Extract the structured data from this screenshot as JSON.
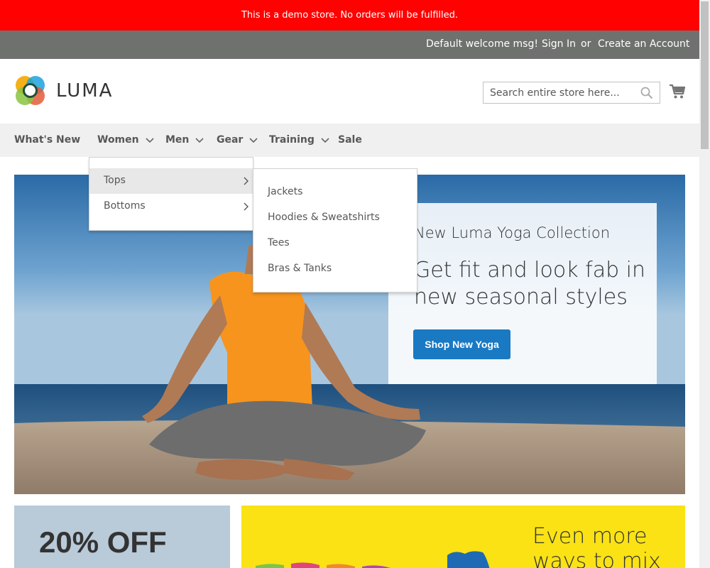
{
  "demo_notice": "This is a demo store. No orders will be fulfilled.",
  "panel": {
    "welcome": "Default welcome msg!",
    "sign_in": "Sign In",
    "or": "or",
    "create_account": "Create an Account"
  },
  "logo": {
    "text": "LUMA"
  },
  "search": {
    "placeholder": "Search entire store here..."
  },
  "nav": {
    "items": [
      {
        "label": "What's New"
      },
      {
        "label": "Women"
      },
      {
        "label": "Men"
      },
      {
        "label": "Gear"
      },
      {
        "label": "Training"
      },
      {
        "label": "Sale"
      }
    ]
  },
  "submenu": {
    "level1": [
      {
        "label": "Tops"
      },
      {
        "label": "Bottoms"
      }
    ],
    "level2": [
      {
        "label": "Jackets"
      },
      {
        "label": "Hoodies & Sweatshirts"
      },
      {
        "label": "Tees"
      },
      {
        "label": "Bras & Tanks"
      }
    ]
  },
  "hero": {
    "subtitle": "New Luma Yoga Collection",
    "title": "Get fit and look fab in new seasonal styles",
    "button": "Shop New Yoga"
  },
  "promos": {
    "left_text": "20% OFF",
    "right_text": "Even more ways to mix"
  },
  "colors": {
    "demo_bar": "#ff0101",
    "panel_bar": "#6e716e",
    "nav_bg": "#f0f0f0",
    "primary_button": "#1979c3",
    "promo_yellow": "#fae215"
  },
  "icons": {
    "search": "search-icon",
    "cart": "cart-icon",
    "chevron": "chevron-down-icon",
    "submenu_arrow": "chevron-right-icon"
  }
}
